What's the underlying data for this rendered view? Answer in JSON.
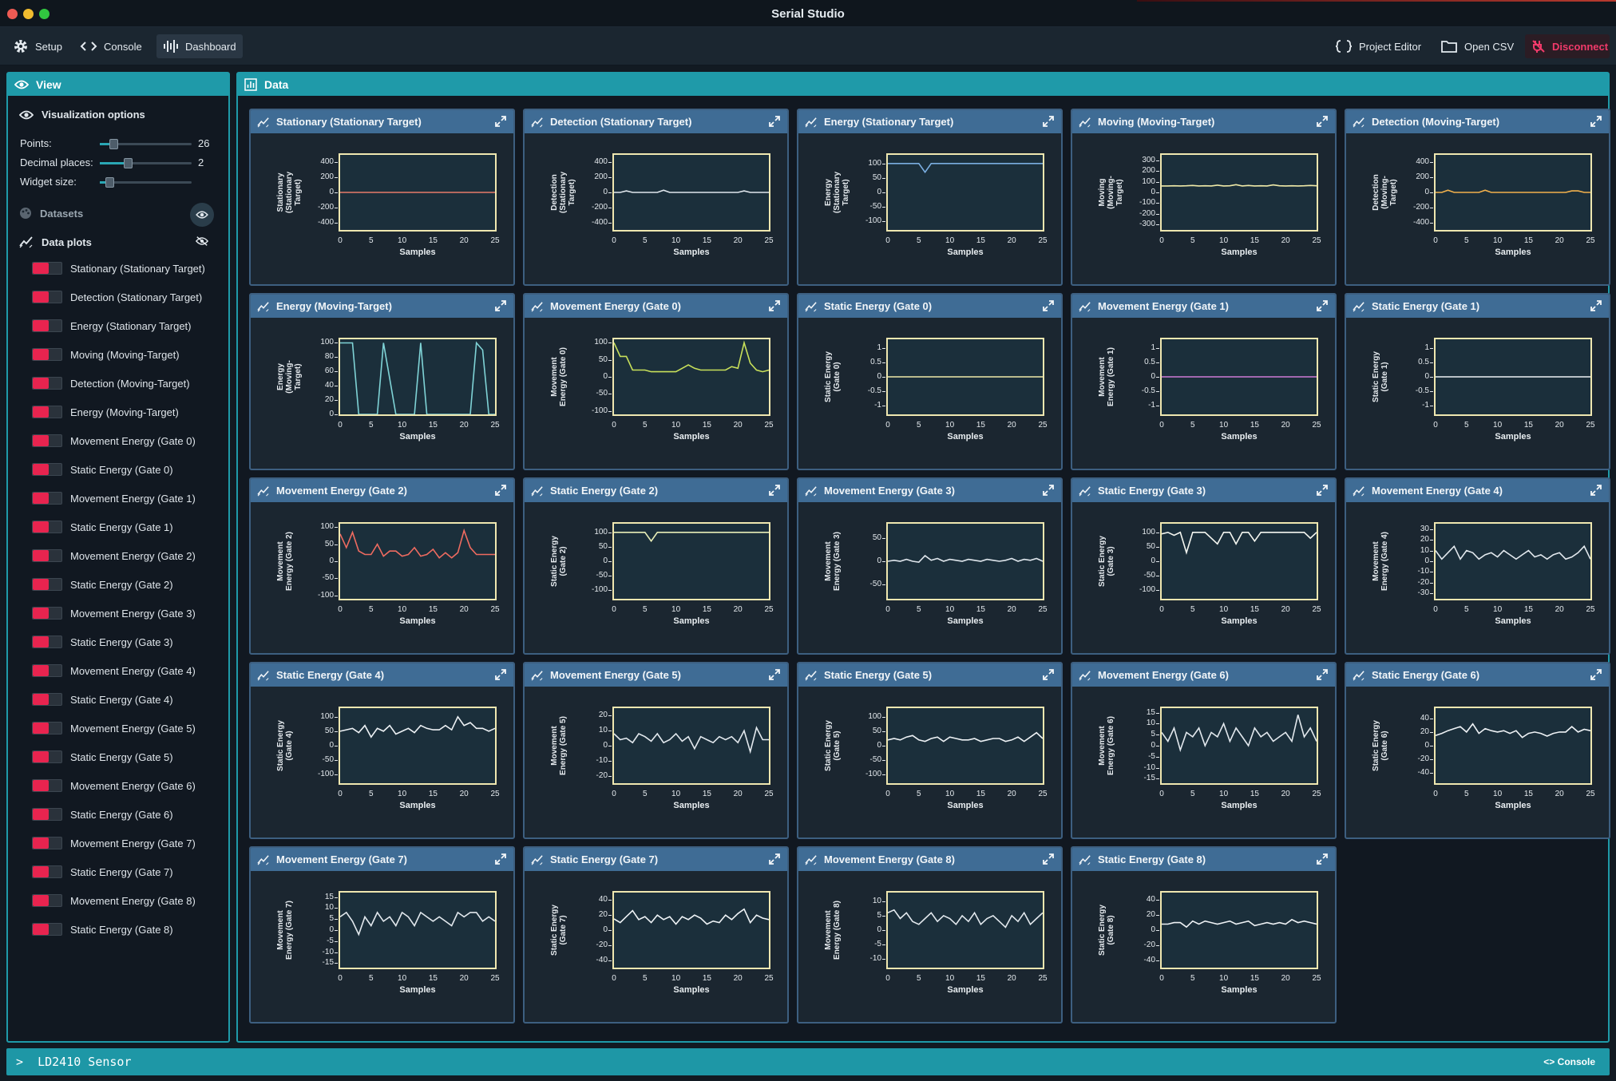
{
  "app": {
    "title": "Serial Studio"
  },
  "toolbar": {
    "setup": "Setup",
    "console": "Console",
    "dashboard": "Dashboard",
    "project_editor": "Project Editor",
    "open_csv": "Open CSV",
    "disconnect": "Disconnect"
  },
  "view_panel": {
    "title": "View",
    "visualization_options": "Visualization options",
    "points_label": "Points:",
    "points_value": "26",
    "points_fraction": 0.15,
    "decimal_label": "Decimal places:",
    "decimal_value": "2",
    "decimal_fraction": 0.3,
    "widget_size_label": "Widget size:",
    "widget_size_fraction": 0.1,
    "datasets_label": "Datasets",
    "data_plots_label": "Data plots",
    "items": [
      "Stationary (Stationary Target)",
      "Detection (Stationary Target)",
      "Energy (Stationary Target)",
      "Moving (Moving-Target)",
      "Detection (Moving-Target)",
      "Energy (Moving-Target)",
      "Movement Energy (Gate 0)",
      "Static Energy (Gate 0)",
      "Movement Energy (Gate 1)",
      "Static Energy (Gate 1)",
      "Movement Energy (Gate 2)",
      "Static Energy (Gate 2)",
      "Movement Energy (Gate 3)",
      "Static Energy (Gate 3)",
      "Movement Energy (Gate 4)",
      "Static Energy (Gate 4)",
      "Movement Energy (Gate 5)",
      "Static Energy (Gate 5)",
      "Movement Energy (Gate 6)",
      "Static Energy (Gate 6)",
      "Movement Energy (Gate 7)",
      "Static Energy (Gate 7)",
      "Movement Energy (Gate 8)",
      "Static Energy (Gate 8)"
    ]
  },
  "data_panel": {
    "title": "Data",
    "x_label": "Samples",
    "x_ticks": [
      "0",
      "5",
      "10",
      "15",
      "20",
      "25"
    ]
  },
  "colors": {
    "accent": "#1f9aa9",
    "disconnect": "#f03a6a",
    "widget_header": "#3f6c95",
    "plot_border": "#efe7b0"
  },
  "widgets": [
    {
      "title": "Stationary (Stationary Target)",
      "ylabel": "Stationary\n(Stationary\nTarget)",
      "yticks": [
        "400",
        "200",
        "0",
        "-200",
        "-400"
      ],
      "ylim": [
        -500,
        500
      ],
      "color": "#e87b6b",
      "values": [
        0,
        0,
        0,
        0,
        0,
        0,
        0,
        0,
        0,
        0,
        0,
        0,
        0,
        0,
        0,
        0,
        0,
        0,
        0,
        0,
        0,
        0,
        0,
        0,
        0,
        0
      ]
    },
    {
      "title": "Detection (Stationary Target)",
      "ylabel": "Detection\n(Stationary\nTarget)",
      "yticks": [
        "400",
        "200",
        "0",
        "-200",
        "-400"
      ],
      "ylim": [
        -500,
        500
      ],
      "color": "#dfe6ec",
      "values": [
        0,
        0,
        20,
        0,
        0,
        0,
        0,
        0,
        30,
        0,
        0,
        0,
        0,
        0,
        0,
        0,
        0,
        0,
        0,
        0,
        0,
        20,
        0,
        0,
        0,
        0
      ]
    },
    {
      "title": "Energy (Stationary Target)",
      "ylabel": "Energy\n(Stationary\nTarget)",
      "yticks": [
        "100",
        "50",
        "0",
        "-50",
        "-100"
      ],
      "ylim": [
        -130,
        130
      ],
      "color": "#7aaee0",
      "values": [
        100,
        100,
        100,
        100,
        100,
        100,
        70,
        100,
        100,
        100,
        100,
        100,
        100,
        100,
        100,
        100,
        100,
        100,
        100,
        100,
        100,
        100,
        100,
        100,
        100,
        100
      ]
    },
    {
      "title": "Moving (Moving-Target)",
      "ylabel": "Moving\n(Moving-\nTarget)",
      "yticks": [
        "300",
        "200",
        "100",
        "0",
        "-100",
        "-200",
        "-300"
      ],
      "ylim": [
        -350,
        350
      ],
      "color": "#f0eaa8",
      "values": [
        60,
        60,
        62,
        60,
        62,
        65,
        60,
        62,
        60,
        68,
        60,
        62,
        72,
        60,
        65,
        60,
        62,
        60,
        70,
        62,
        60,
        62,
        60,
        62,
        65,
        62
      ]
    },
    {
      "title": "Detection (Moving-Target)",
      "ylabel": "Detection\n(Moving-\nTarget)",
      "yticks": [
        "400",
        "200",
        "0",
        "-200",
        "-400"
      ],
      "ylim": [
        -500,
        500
      ],
      "color": "#f2b14c",
      "values": [
        0,
        0,
        30,
        0,
        0,
        0,
        0,
        0,
        30,
        0,
        0,
        0,
        0,
        0,
        0,
        0,
        0,
        0,
        0,
        0,
        0,
        0,
        20,
        20,
        0,
        0
      ]
    },
    {
      "title": "Energy (Moving-Target)",
      "ylabel": "Energy\n(Moving-\nTarget)",
      "yticks": [
        "100",
        "80",
        "60",
        "40",
        "20",
        "0"
      ],
      "ylim": [
        0,
        105
      ],
      "color": "#7fd3d6",
      "values": [
        100,
        100,
        100,
        0,
        0,
        0,
        0,
        100,
        50,
        0,
        0,
        0,
        0,
        100,
        0,
        0,
        0,
        0,
        0,
        0,
        0,
        0,
        100,
        90,
        0,
        0
      ]
    },
    {
      "title": "Movement Energy (Gate 0)",
      "ylabel": "Movement\nEnergy (Gate 0)",
      "yticks": [
        "100",
        "50",
        "0",
        "-50",
        "-100"
      ],
      "ylim": [
        -110,
        110
      ],
      "color": "#c8e05a",
      "values": [
        100,
        60,
        60,
        20,
        20,
        20,
        15,
        15,
        15,
        15,
        15,
        25,
        35,
        25,
        20,
        20,
        20,
        20,
        20,
        30,
        25,
        100,
        40,
        20,
        15,
        20
      ]
    },
    {
      "title": "Static Energy (Gate 0)",
      "ylabel": "Static Energy\n(Gate 0)",
      "yticks": [
        "1",
        "0.5",
        "0",
        "-0.5",
        "-1"
      ],
      "ylim": [
        -1.3,
        1.3
      ],
      "color": "#f0eaa8",
      "values": [
        0,
        0,
        0,
        0,
        0,
        0,
        0,
        0,
        0,
        0,
        0,
        0,
        0,
        0,
        0,
        0,
        0,
        0,
        0,
        0,
        0,
        0,
        0,
        0,
        0,
        0
      ]
    },
    {
      "title": "Movement Energy (Gate 1)",
      "ylabel": "Movement\nEnergy (Gate 1)",
      "yticks": [
        "1",
        "0.5",
        "0",
        "-0.5",
        "-1"
      ],
      "ylim": [
        -1.3,
        1.3
      ],
      "color": "#d07ad6",
      "values": [
        0,
        0,
        0,
        0,
        0,
        0,
        0,
        0,
        0,
        0,
        0,
        0,
        0,
        0,
        0,
        0,
        0,
        0,
        0,
        0,
        0,
        0,
        0,
        0,
        0,
        0
      ]
    },
    {
      "title": "Static Energy (Gate 1)",
      "ylabel": "Static Energy\n(Gate 1)",
      "yticks": [
        "1",
        "0.5",
        "0",
        "-0.5",
        "-1"
      ],
      "ylim": [
        -1.3,
        1.3
      ],
      "color": "#eef2f5",
      "values": [
        0,
        0,
        0,
        0,
        0,
        0,
        0,
        0,
        0,
        0,
        0,
        0,
        0,
        0,
        0,
        0,
        0,
        0,
        0,
        0,
        0,
        0,
        0,
        0,
        0,
        0
      ]
    },
    {
      "title": "Movement Energy (Gate 2)",
      "ylabel": "Movement\nEnergy (Gate 2)",
      "yticks": [
        "100",
        "50",
        "0",
        "-50",
        "-100"
      ],
      "ylim": [
        -110,
        110
      ],
      "color": "#ef6b60",
      "values": [
        80,
        40,
        85,
        30,
        20,
        20,
        50,
        15,
        30,
        30,
        15,
        20,
        40,
        15,
        20,
        35,
        10,
        25,
        10,
        25,
        90,
        40,
        20,
        20,
        20,
        20
      ]
    },
    {
      "title": "Static Energy (Gate 2)",
      "ylabel": "Static Energy\n(Gate 2)",
      "yticks": [
        "100",
        "50",
        "0",
        "-50",
        "-100"
      ],
      "ylim": [
        -130,
        130
      ],
      "color": "#e8eeb8",
      "values": [
        100,
        100,
        100,
        100,
        100,
        100,
        70,
        100,
        100,
        100,
        100,
        100,
        100,
        100,
        100,
        100,
        100,
        100,
        100,
        100,
        100,
        100,
        100,
        100,
        100,
        100
      ]
    },
    {
      "title": "Movement Energy (Gate 3)",
      "ylabel": "Movement\nEnergy (Gate 3)",
      "yticks": [
        "50",
        "0",
        "-50"
      ],
      "ylim": [
        -80,
        80
      ],
      "color": "#dfe6ec",
      "values": [
        0,
        2,
        0,
        4,
        0,
        -2,
        12,
        2,
        6,
        0,
        4,
        2,
        0,
        4,
        2,
        0,
        4,
        2,
        0,
        2,
        6,
        0,
        4,
        2,
        6,
        0
      ]
    },
    {
      "title": "Static Energy (Gate 3)",
      "ylabel": "Static Energy\n(Gate 3)",
      "yticks": [
        "100",
        "50",
        "0",
        "-50",
        "-100"
      ],
      "ylim": [
        -130,
        130
      ],
      "color": "#f4f6f0",
      "values": [
        95,
        100,
        90,
        100,
        30,
        100,
        100,
        100,
        80,
        60,
        100,
        100,
        60,
        100,
        100,
        70,
        100,
        100,
        100,
        100,
        100,
        100,
        100,
        100,
        80,
        100
      ]
    },
    {
      "title": "Movement Energy (Gate 4)",
      "ylabel": "Movement\nEnergy (Gate 4)",
      "yticks": [
        "30",
        "20",
        "10",
        "0",
        "-10",
        "-20",
        "-30"
      ],
      "ylim": [
        -35,
        35
      ],
      "color": "#e2e8ed",
      "values": [
        10,
        2,
        8,
        14,
        2,
        10,
        8,
        2,
        6,
        8,
        4,
        10,
        6,
        2,
        6,
        10,
        4,
        6,
        2,
        6,
        8,
        2,
        4,
        8,
        14,
        2
      ]
    },
    {
      "title": "Static Energy (Gate 4)",
      "ylabel": "Static Energy\n(Gate 4)",
      "yticks": [
        "100",
        "50",
        "0",
        "-50",
        "-100"
      ],
      "ylim": [
        -130,
        130
      ],
      "color": "#eef2f5",
      "values": [
        50,
        55,
        60,
        45,
        70,
        30,
        60,
        50,
        70,
        40,
        50,
        60,
        45,
        70,
        60,
        55,
        55,
        70,
        55,
        100,
        70,
        80,
        60,
        60,
        50,
        60
      ]
    },
    {
      "title": "Movement Energy (Gate 5)",
      "ylabel": "Movement\nEnergy (Gate 5)",
      "yticks": [
        "20",
        "10",
        "0",
        "-10",
        "-20"
      ],
      "ylim": [
        -25,
        25
      ],
      "color": "#e2e8ed",
      "values": [
        8,
        4,
        5,
        2,
        8,
        6,
        3,
        8,
        2,
        4,
        8,
        3,
        6,
        -2,
        6,
        4,
        2,
        6,
        4,
        6,
        2,
        10,
        -4,
        12,
        4,
        4
      ]
    },
    {
      "title": "Static Energy (Gate 5)",
      "ylabel": "Static Energy\n(Gate 5)",
      "yticks": [
        "100",
        "50",
        "0",
        "-50",
        "-100"
      ],
      "ylim": [
        -130,
        130
      ],
      "color": "#eef2f5",
      "values": [
        20,
        25,
        20,
        30,
        35,
        20,
        15,
        25,
        30,
        15,
        30,
        25,
        20,
        20,
        25,
        15,
        20,
        25,
        25,
        15,
        20,
        30,
        15,
        30,
        45,
        25
      ]
    },
    {
      "title": "Movement Energy (Gate 6)",
      "ylabel": "Movement\nEnergy (Gate 6)",
      "yticks": [
        "15",
        "10",
        "5",
        "0",
        "-5",
        "-10",
        "-15"
      ],
      "ylim": [
        -17,
        17
      ],
      "color": "#e2e8ed",
      "values": [
        6,
        2,
        8,
        -2,
        6,
        4,
        8,
        0,
        6,
        4,
        10,
        2,
        8,
        4,
        0,
        8,
        4,
        6,
        2,
        4,
        6,
        2,
        14,
        4,
        8,
        2
      ]
    },
    {
      "title": "Static Energy (Gate 6)",
      "ylabel": "Static Energy\n(Gate 6)",
      "yticks": [
        "40",
        "20",
        "0",
        "-20",
        "-40"
      ],
      "ylim": [
        -55,
        55
      ],
      "color": "#eef2f5",
      "values": [
        15,
        18,
        22,
        25,
        28,
        20,
        32,
        18,
        25,
        22,
        20,
        22,
        18,
        22,
        12,
        18,
        20,
        18,
        14,
        18,
        20,
        20,
        28,
        20,
        24,
        22
      ]
    },
    {
      "title": "Movement Energy (Gate 7)",
      "ylabel": "Movement\nEnergy (Gate 7)",
      "yticks": [
        "15",
        "10",
        "5",
        "0",
        "-5",
        "-10",
        "-15"
      ],
      "ylim": [
        -17,
        17
      ],
      "color": "#e2e8ed",
      "values": [
        6,
        8,
        4,
        -2,
        6,
        2,
        8,
        4,
        6,
        2,
        8,
        6,
        2,
        8,
        6,
        4,
        6,
        4,
        2,
        8,
        6,
        8,
        8,
        4,
        6,
        4
      ]
    },
    {
      "title": "Static Energy (Gate 7)",
      "ylabel": "Static Energy\n(Gate 7)",
      "yticks": [
        "40",
        "20",
        "0",
        "-20",
        "-40"
      ],
      "ylim": [
        -50,
        50
      ],
      "color": "#eef2f5",
      "values": [
        15,
        10,
        18,
        26,
        14,
        18,
        10,
        20,
        14,
        18,
        8,
        18,
        14,
        20,
        16,
        8,
        12,
        10,
        20,
        14,
        22,
        28,
        10,
        20,
        16,
        14
      ]
    },
    {
      "title": "Movement Energy (Gate 8)",
      "ylabel": "Movement\nEnergy (Gate 8)",
      "yticks": [
        "10",
        "5",
        "0",
        "-5",
        "-10"
      ],
      "ylim": [
        -13,
        13
      ],
      "color": "#e2e8ed",
      "values": [
        6,
        7,
        4,
        6,
        3,
        2,
        4,
        6,
        3,
        5,
        4,
        2,
        5,
        3,
        6,
        2,
        4,
        5,
        3,
        1,
        5,
        3,
        6,
        2,
        4,
        6
      ]
    },
    {
      "title": "Static Energy (Gate 8)",
      "ylabel": "Static Energy\n(Gate 8)",
      "yticks": [
        "40",
        "20",
        "0",
        "-20",
        "-40"
      ],
      "ylim": [
        -50,
        50
      ],
      "color": "#eef2f5",
      "values": [
        8,
        8,
        10,
        10,
        4,
        12,
        8,
        12,
        10,
        8,
        10,
        12,
        8,
        10,
        12,
        6,
        8,
        10,
        8,
        10,
        8,
        14,
        10,
        12,
        10,
        8
      ]
    }
  ],
  "status": {
    "device": "LD2410 Sensor",
    "console": "Console"
  }
}
